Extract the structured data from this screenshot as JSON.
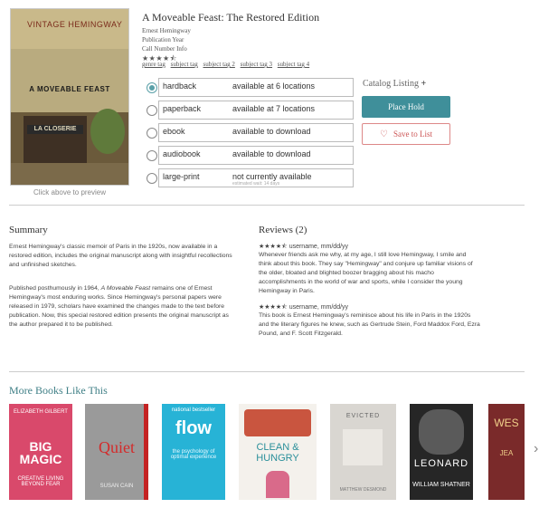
{
  "book": {
    "title": "A Moveable Feast: The Restored Edition",
    "author": "Ernest Hemingway",
    "publication_year": "Publication Year",
    "call_number": "Call Number Info",
    "rating_stars": "★★★★⯪",
    "preview_note": "Click above to preview",
    "tags": [
      "genre tag",
      "subject tag",
      "subject tag 2",
      "subject tag 3",
      "subject tag 4"
    ],
    "cover": {
      "brand": "VINTAGE HEMINGWAY",
      "title": "A MOVEABLE FEAST",
      "sign": "LA CLOSERIE"
    }
  },
  "formats": [
    {
      "name": "hardback",
      "availability": "available at 6 locations",
      "selected": true,
      "wait": ""
    },
    {
      "name": "paperback",
      "availability": "available at 7 locations",
      "selected": false,
      "wait": ""
    },
    {
      "name": "ebook",
      "availability": "available to download",
      "selected": false,
      "wait": ""
    },
    {
      "name": "audiobook",
      "availability": "available to download",
      "selected": false,
      "wait": ""
    },
    {
      "name": "large-print",
      "availability": "not currently available",
      "selected": false,
      "wait": "estimated wait: 14 days"
    }
  ],
  "actions": {
    "catalog_listing": "Catalog Listing",
    "catalog_plus": "+",
    "place_hold": "Place Hold",
    "save_to_list": "Save to List"
  },
  "summary": {
    "heading": "Summary",
    "p1": "Ernest Hemingway's classic memoir of Paris in the 1920s, now available in a restored edition, includes the original manuscript along with insightful recollections and unfinished sketches.",
    "p2_before": "Published posthumously in 1964, ",
    "p2_italic": "A Moveable Feast",
    "p2_after": " remains one of Ernest Hemingway's most enduring works. Since Hemingway's personal papers were released in 1979, scholars have examined the changes made to the text before publication. Now, this special restored edition presents the original manuscript as the author prepared it to be published."
  },
  "reviews": {
    "heading": "Reviews (2)",
    "items": [
      {
        "stars": "★★★★⯪",
        "byline": "username, mm/dd/yy",
        "text": "Whenever friends ask me why, at my age, I still love Hemingway, I smile and think about this book. They say \"Hemingway\" and conjure up familiar visions of the older, bloated and blighted boozer bragging about his macho accomplishments in the world of war and sports, while I consider the young Hemingway in Paris."
      },
      {
        "stars": "★★★★⯪",
        "byline": "username, mm/dd/yy",
        "text": "This book is Ernest Hemingway's reminisce about his life in Paris in the 1920s and the literary figures he knew, such as Gertrude Stein, Ford Maddox Ford, Ezra Pound, and F. Scott Fitzgerald."
      }
    ]
  },
  "more_books": {
    "heading": "More Books Like This",
    "items": [
      {
        "top": "ELIZABETH GILBERT",
        "main": "BIG MAGIC",
        "sub": "CREATIVE LIVING BEYOND FEAR",
        "bg": "#d9496b",
        "fg": "#ffffff"
      },
      {
        "top": "",
        "main": "Quiet",
        "sub": "SUSAN CAIN",
        "bg": "#9a9a9a",
        "fg": "#d42a2a"
      },
      {
        "top": "national bestseller",
        "main": "flow",
        "sub": "the psychology of optimal experience",
        "bg": "#27b3d6",
        "fg": "#ffffff"
      },
      {
        "top": "",
        "main": "CLEAN & HUNGRY",
        "sub": "",
        "bg": "#f4f1ec",
        "fg": "#2a8f9a"
      },
      {
        "top": "",
        "main": "EVICTED",
        "sub": "MATTHEW DESMOND",
        "bg": "#d9d6d1",
        "fg": "#555555"
      },
      {
        "top": "",
        "main": "LEONARD",
        "sub": "WILLIAM SHATNER",
        "bg": "#262626",
        "fg": "#ffffff"
      },
      {
        "top": "",
        "main": "WES",
        "sub": "JEA",
        "bg": "#7a2a2a",
        "fg": "#f0d08a"
      }
    ]
  },
  "colors": {
    "accent": "#3f8f9a",
    "heart": "#cc5555"
  },
  "icons": {
    "next": "chevron-right-icon",
    "save": "heart-icon",
    "plus": "plus-icon"
  }
}
